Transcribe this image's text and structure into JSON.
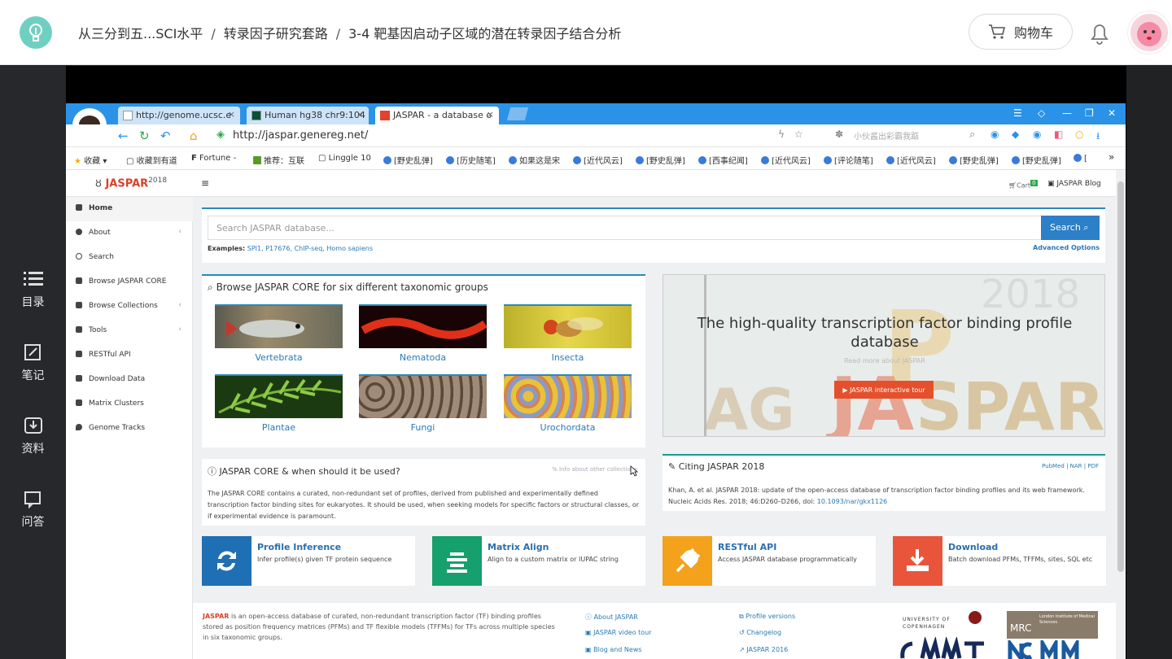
{
  "breadcrumb": {
    "item1": "从三分到五...SCI水平",
    "sep": "/",
    "item2": "转录因子研究套路",
    "item3": "3-4 靶基因启动子区域的潜在转录因子结合分析"
  },
  "header": {
    "cart_label": "购物车"
  },
  "leftnav": {
    "items": [
      {
        "label": "目录",
        "icon": "list-icon"
      },
      {
        "label": "笔记",
        "icon": "edit-note-icon"
      },
      {
        "label": "资料",
        "icon": "download-icon"
      },
      {
        "label": "问答",
        "icon": "qa-icon"
      }
    ]
  },
  "browser": {
    "tabs": [
      {
        "label": "http://genome.ucsc.e",
        "close": "×"
      },
      {
        "label": "Human hg38 chr9:104",
        "close": "×"
      },
      {
        "label": "JASPAR - a database o",
        "close": "×"
      }
    ],
    "url": "http://jaspar.genereg.net/",
    "search_placeholder": "小伙酱出彩霸我踮",
    "bookmarks": [
      "收藏",
      "收藏到有道",
      "Fortune -",
      "推荐：互联",
      "Linggle 10",
      "[野史乱弹]",
      "[历史随笔]",
      "如果这是宋",
      "[近代风云]",
      "[野史乱弹]",
      "[西事纪闻]",
      "[近代风云]",
      "[评论随笔]",
      "[近代风云]",
      "[野史乱弹]",
      "[野史乱弹]",
      "[",
      "»"
    ]
  },
  "jaspar": {
    "logo": "JASPAR",
    "logo_year": "2018",
    "menu_icon": "≡",
    "cart": "Cart",
    "cart_count": "0",
    "blog": "JASPAR Blog",
    "sidebar": [
      {
        "label": "Home",
        "chevron": ""
      },
      {
        "label": "About",
        "chevron": "‹"
      },
      {
        "label": "Search",
        "chevron": ""
      },
      {
        "label": "Browse JASPAR CORE",
        "chevron": ""
      },
      {
        "label": "Browse Collections",
        "chevron": "‹"
      },
      {
        "label": "Tools",
        "chevron": "‹"
      },
      {
        "label": "RESTful API",
        "chevron": ""
      },
      {
        "label": "Download Data",
        "chevron": ""
      },
      {
        "label": "Matrix Clusters",
        "chevron": ""
      },
      {
        "label": "Genome Tracks",
        "chevron": ""
      }
    ],
    "search": {
      "placeholder": "Search JASPAR database...",
      "button": "Search",
      "examples_label": "Examples:",
      "examples": "SPI1, P17676, ChIP-seq, Homo sapiens",
      "advanced": "Advanced Options"
    },
    "browse": {
      "title": "Browse JASPAR CORE for six different taxonomic groups",
      "groups": [
        "Vertebrata",
        "Nematoda",
        "Insecta",
        "Plantae",
        "Fungi",
        "Urochordata"
      ]
    },
    "hero": {
      "title": "The high-quality transcription factor binding profile database",
      "more": "Read more about JASPAR",
      "button": "▶ JASPAR interactive tour"
    },
    "core": {
      "title": "JASPAR CORE & when should it be used?",
      "link": "Info about other collections",
      "text": "The JASPAR CORE contains a curated, non-redundant set of profiles, derived from published and experimentally defined transcription factor binding sites for eukaryotes. It should be used, when seeking models for specific factors or structural classes, or if experimental evidence is paramount."
    },
    "cite": {
      "title": "Citing JASPAR 2018",
      "links": "PubMed | NAR | PDF",
      "text": "Khan, A. et al. JASPAR 2018: update of the open-access database of transcription factor binding profiles and its web framework.",
      "text2": "Nucleic Acids Res. 2018; 46:D260–D266, doi:",
      "doi": "10.1093/nar/gkx1126"
    },
    "cards": [
      {
        "title": "Profile Inference",
        "desc": "Infer profile(s) given TF protein sequence",
        "color": "#1f6fb5"
      },
      {
        "title": "Matrix Align",
        "desc": "Align to a custom matrix or IUPAC string",
        "color": "#16a06d"
      },
      {
        "title": "RESTful API",
        "desc": "Access JASPAR database programmatically",
        "color": "#f4a11c"
      },
      {
        "title": "Download",
        "desc": "Batch download PFMs, TFFMs, sites, SQL etc",
        "color": "#e9553b"
      }
    ],
    "footer": {
      "brand": "JASPAR",
      "desc": "is an open-access database of curated, non-redundant transcription factor (TF) binding profiles stored as position frequency matrices (PFMs) and TF flexible models (TFFMs) for TFs across multiple species in six taxonomic groups.",
      "links1": [
        "About JASPAR",
        "JASPAR video tour",
        "Blog and News"
      ],
      "links2": [
        "Profile versions",
        "Changelog",
        "JASPAR 2016"
      ],
      "uni": "UNIVERSITY OF COPENHAGEN",
      "mrc": "MRC",
      "mrc_sub": "London Institute of Medical Sciences"
    }
  }
}
